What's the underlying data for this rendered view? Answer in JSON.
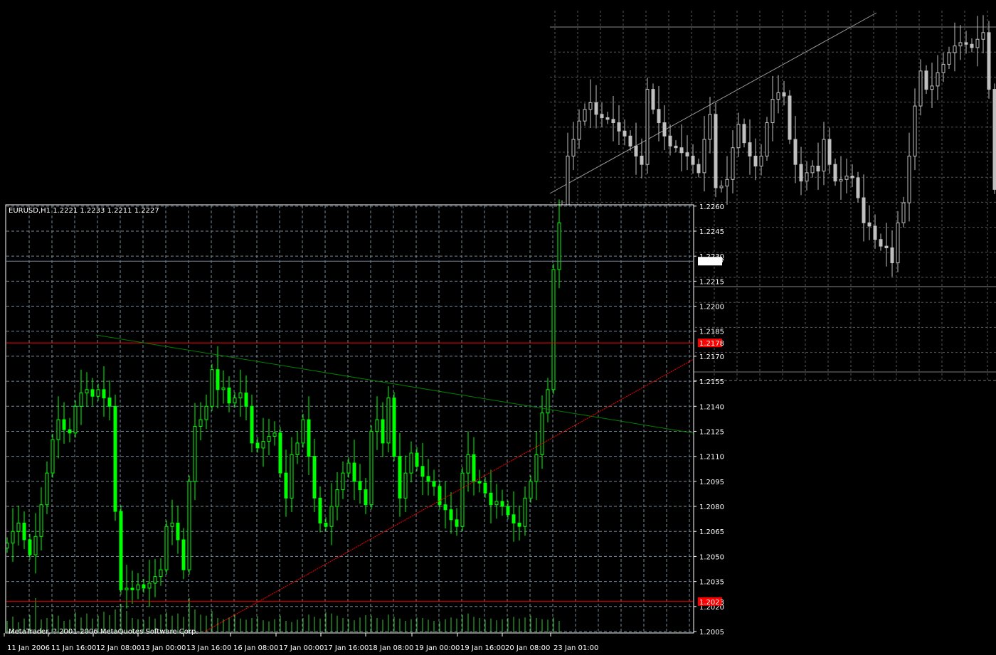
{
  "chart_data": {
    "type": "candlestick",
    "symbol_header": "EURUSD,H1  1.2221 1.2233 1.2211 1.2227",
    "copyright": "MetaTrader, ? 2001-2006 MetaQuotes Software Corp.",
    "ylim": [
      1.2,
      1.226
    ],
    "grid": true,
    "colors": {
      "background": "#000000",
      "candle": "#00ff00",
      "overlay_candle": "#c0c0c0",
      "grid": "#778899",
      "axis": "#ffffff",
      "bid_line": "#778899",
      "red_line": "#ff0000",
      "green_trend": "#008000",
      "red_trend": "#ff0000",
      "volume": "#32cd32"
    },
    "y_ticks": [
      "1.2260",
      "1.2245",
      "1.2230",
      "1.2215",
      "1.2200",
      "1.2185",
      "1.2170",
      "1.2155",
      "1.2140",
      "1.2125",
      "1.2110",
      "1.2095",
      "1.2080",
      "1.2065",
      "1.2050",
      "1.2035",
      "1.2020",
      "1.2005"
    ],
    "x_ticks": [
      "11 Jan 2006",
      "11 Jan 16:00",
      "12 Jan 08:00",
      "13 Jan 00:00",
      "13 Jan 16:00",
      "16 Jan 08:00",
      "17 Jan 00:00",
      "17 Jan 16:00",
      "18 Jan 08:00",
      "19 Jan 00:00",
      "19 Jan 16:00",
      "20 Jan 08:00",
      "23 Jan 01:00"
    ],
    "price_labels": [
      {
        "text": "1.2227",
        "value": 1.2227,
        "style": "bid"
      },
      {
        "text": "1.2178",
        "value": 1.2178,
        "style": "red"
      },
      {
        "text": "1.2023",
        "value": 1.2023,
        "style": "red"
      }
    ],
    "closes": [
      1.2058,
      1.2065,
      1.207,
      1.206,
      1.2051,
      1.2062,
      1.2081,
      1.21,
      1.212,
      1.2132,
      1.2126,
      1.2124,
      1.214,
      1.2148,
      1.215,
      1.2146,
      1.215,
      1.2145,
      1.214,
      1.2077,
      1.203,
      1.2031,
      1.203,
      1.2033,
      1.2031,
      1.2034,
      1.2038,
      1.2042,
      1.2068,
      1.207,
      1.206,
      1.2042,
      1.2095,
      1.2128,
      1.2132,
      1.214,
      1.2162,
      1.215,
      1.2151,
      1.2142,
      1.2145,
      1.2148,
      1.214,
      1.2118,
      1.2115,
      1.2119,
      1.2122,
      1.2124,
      1.21,
      1.2085,
      1.2111,
      1.2118,
      1.2132,
      1.211,
      1.2085,
      1.207,
      1.2068,
      1.208,
      1.209,
      1.21,
      1.2106,
      1.2095,
      1.209,
      1.2081,
      1.2125,
      1.2132,
      1.2118,
      1.2145,
      1.211,
      1.2085,
      1.21,
      1.2112,
      1.2104,
      1.2098,
      1.2095,
      1.2092,
      1.2081,
      1.2078,
      1.2072,
      1.2068,
      1.21,
      1.2111,
      1.2095,
      1.2094,
      1.2088,
      1.2081,
      1.2083,
      1.208,
      1.2075,
      1.207,
      1.2068,
      1.2085,
      1.2095,
      1.2111,
      1.2136,
      1.215,
      1.2222,
      1.225
    ],
    "volumes": [
      40,
      55,
      35,
      48,
      60,
      120,
      45,
      50,
      62,
      58,
      40,
      44,
      70,
      52,
      66,
      48,
      58,
      72,
      60,
      80,
      100,
      75,
      50,
      46,
      42,
      55,
      48,
      62,
      70,
      58,
      66,
      54,
      120,
      80,
      62,
      58,
      74,
      50,
      46,
      52,
      60,
      48,
      44,
      50,
      56,
      42,
      38,
      46,
      58,
      40,
      36,
      44,
      50,
      62,
      54,
      48,
      70,
      66,
      58,
      50,
      46,
      42,
      52,
      60,
      58,
      50,
      44,
      62,
      54,
      48,
      40,
      46,
      52,
      50,
      44,
      40,
      38,
      46,
      52,
      48,
      60,
      66,
      54,
      50,
      44,
      48,
      42,
      46,
      50,
      54,
      48,
      52,
      58,
      50,
      46,
      44,
      52,
      40
    ],
    "overlay_closes": [
      1.226,
      1.229,
      1.23,
      1.2311,
      1.2318,
      1.2322,
      1.2315,
      1.2313,
      1.2312,
      1.231,
      1.2305,
      1.2302,
      1.2296,
      1.229,
      1.2285,
      1.233,
      1.2318,
      1.231,
      1.2302,
      1.2296,
      1.2295,
      1.2292,
      1.229,
      1.2285,
      1.228,
      1.23,
      1.2315,
      1.2271,
      1.2272,
      1.2276,
      1.2295,
      1.2309,
      1.2298,
      1.229,
      1.2284,
      1.229,
      1.231,
      1.2324,
      1.2328,
      1.2326,
      1.23,
      1.2285,
      1.2275,
      1.228,
      1.2284,
      1.2281,
      1.23,
      1.2285,
      1.2275,
      1.2276,
      1.2278,
      1.2277,
      1.2265,
      1.225,
      1.2248,
      1.224,
      1.2236,
      1.2235,
      1.2226,
      1.225,
      1.2262,
      1.229,
      1.232,
      1.2341,
      1.233,
      1.2332,
      1.234,
      1.2345,
      1.2352,
      1.2356,
      1.2358,
      1.2357,
      1.2355,
      1.236,
      1.2364,
      1.233,
      1.227
    ]
  }
}
